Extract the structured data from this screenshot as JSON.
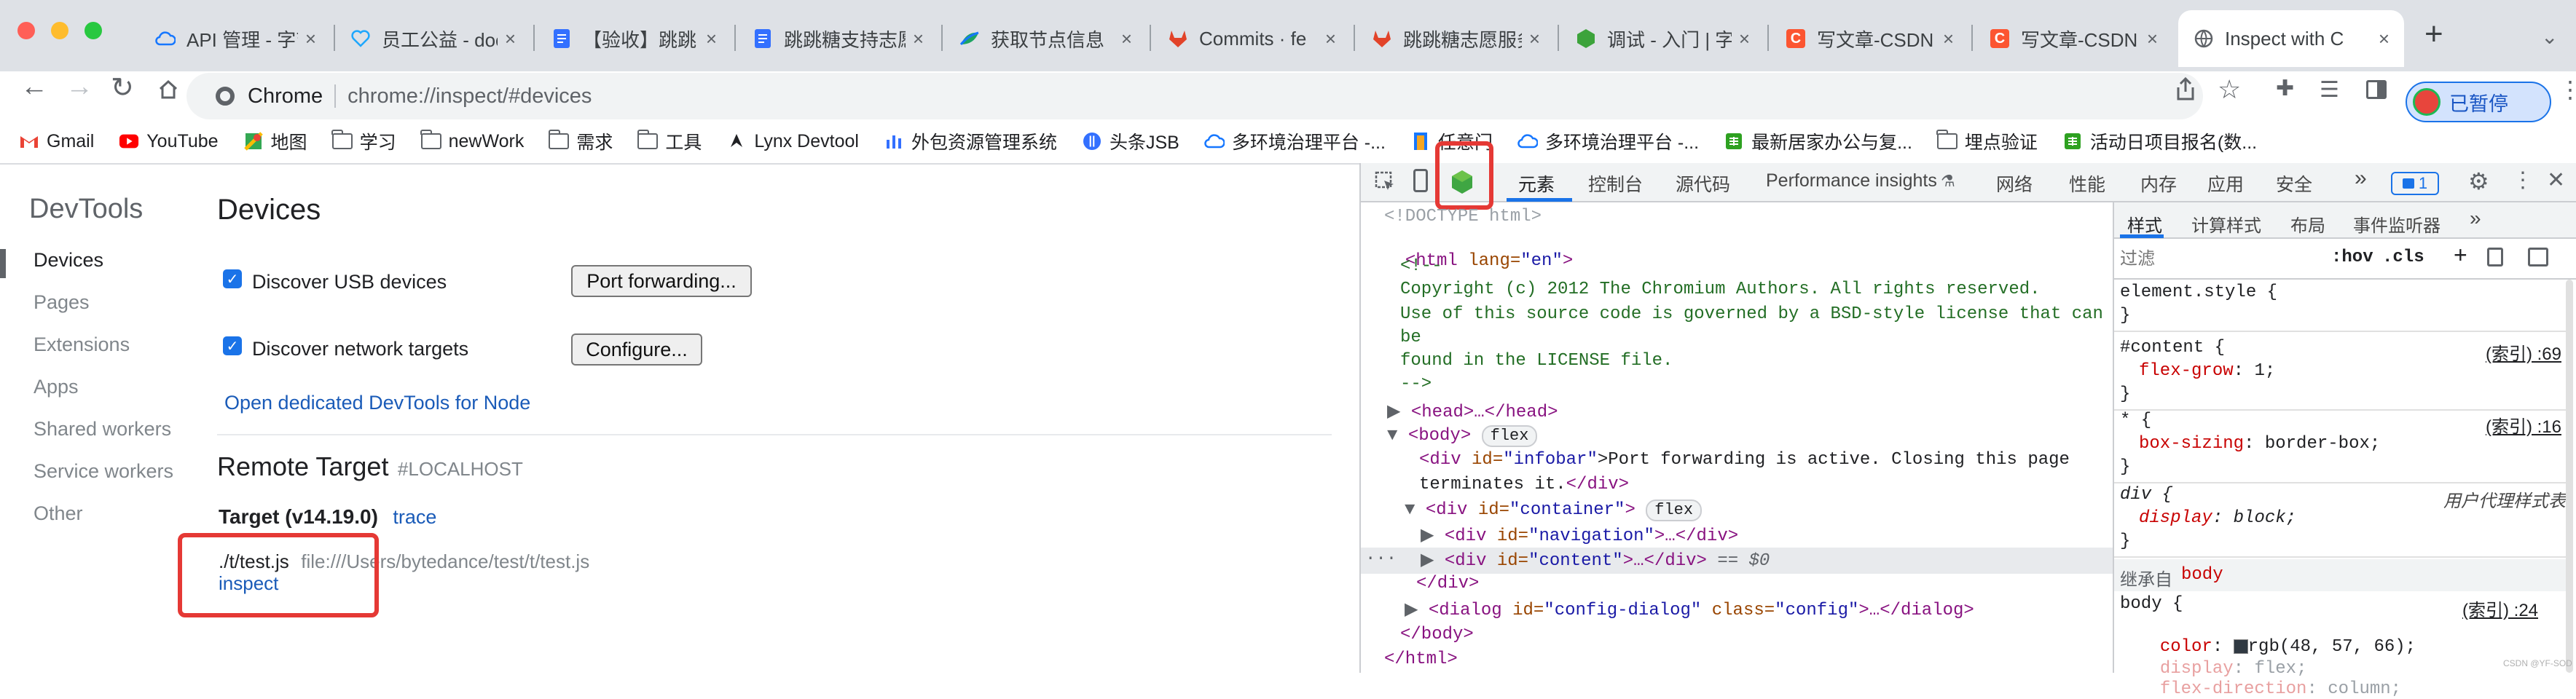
{
  "browser": {
    "tabs": [
      {
        "label": "API 管理 - 字节",
        "icon": "cloud-icon",
        "color": "#1677ff"
      },
      {
        "label": "员工公益 - doc",
        "icon": "heart-icon",
        "color": "#1ea7fd"
      },
      {
        "label": "【验收】跳跳",
        "icon": "doc-icon",
        "color": "#3370ff"
      },
      {
        "label": "跳跳糖支持志愿",
        "icon": "doc-icon",
        "color": "#3370ff"
      },
      {
        "label": "获取节点信息",
        "icon": "leaf-icon",
        "color": "#1da462"
      },
      {
        "label": "Commits · fe",
        "icon": "gitlab-icon",
        "color": "#e24329"
      },
      {
        "label": "跳跳糖志愿服务",
        "icon": "gitlab-icon",
        "color": "#e24329"
      },
      {
        "label": "调试 - 入门 | 字",
        "icon": "hexagon-icon",
        "color": "#3ca33b"
      },
      {
        "label": "写文章-CSDN",
        "icon": "csdn-icon",
        "color": "#fc5531"
      },
      {
        "label": "写文章-CSDN",
        "icon": "csdn-icon",
        "color": "#fc5531"
      },
      {
        "label": "Inspect with C",
        "icon": "globe-icon",
        "color": "#5f6368",
        "active": true
      }
    ],
    "url_scheme_label": "Chrome",
    "url": "chrome://inspect/#devices",
    "paused_label": "已暂停",
    "bookmarks": [
      {
        "label": "Gmail",
        "icon": "gmail-icon"
      },
      {
        "label": "YouTube",
        "icon": "youtube-icon"
      },
      {
        "label": "地图",
        "icon": "maps-icon"
      },
      {
        "label": "学习",
        "icon": "folder-icon"
      },
      {
        "label": "newWork",
        "icon": "folder-icon"
      },
      {
        "label": "需求",
        "icon": "folder-icon"
      },
      {
        "label": "工具",
        "icon": "folder-icon"
      },
      {
        "label": "Lynx Devtool",
        "icon": "lynx-icon"
      },
      {
        "label": "外包资源管理系统",
        "icon": "bar-chart-icon"
      },
      {
        "label": "头条JSB",
        "icon": "jsb-icon"
      },
      {
        "label": "多环境治理平台 -...",
        "icon": "cloud-icon"
      },
      {
        "label": "任意门",
        "icon": "door-icon"
      },
      {
        "label": "多环境治理平台 -...",
        "icon": "cloud-icon"
      },
      {
        "label": "最新居家办公与复...",
        "icon": "sheet-icon"
      },
      {
        "label": "埋点验证",
        "icon": "folder-icon"
      },
      {
        "label": "活动日项目报名(数...",
        "icon": "sheet-icon"
      }
    ]
  },
  "inspect": {
    "sidebar_title": "DevTools",
    "sidebar_items": [
      "Devices",
      "Pages",
      "Extensions",
      "Apps",
      "Shared workers",
      "Service workers",
      "Other"
    ],
    "heading": "Devices",
    "usb_label": "Discover USB devices",
    "port_forwarding_label": "Port forwarding...",
    "network_label": "Discover network targets",
    "configure_label": "Configure...",
    "node_link": "Open dedicated DevTools for Node",
    "remote_title": "Remote Target",
    "remote_host": "#LOCALHOST",
    "target_name": "Target (v14.19.0)",
    "trace_link": "trace",
    "script_name": "./t/test.js",
    "script_path": "file:///Users/bytedance/test/t/test.js",
    "inspect_link": "inspect"
  },
  "devtools": {
    "tabs": [
      "元素",
      "控制台",
      "源代码",
      "Performance insights",
      "网络",
      "性能",
      "内存",
      "应用",
      "安全"
    ],
    "more_tabs": "»",
    "issues_count": "1",
    "elements": {
      "doctype": "<!DOCTYPE html>",
      "html_open_tag": "<html",
      "html_lang_attr": " lang=",
      "html_lang_val": "\"en\"",
      "html_close_bracket": ">",
      "comment_open": "<!--",
      "comment_line1": "Copyright (c) 2012 The Chromium Authors. All rights reserved.",
      "comment_line2": "Use of this source code is governed by a BSD-style license that can",
      "comment_line3": "be",
      "comment_line4": "found in the LICENSE file.",
      "comment_close": "-->",
      "head_line": "<head>…</head>",
      "body_open": "<body>",
      "flex_badge": "flex",
      "infobar_open": "<div",
      "infobar_attr": " id=",
      "infobar_val": "\"infobar\"",
      "infobar_text": ">Port forwarding is active. Closing this page",
      "infobar_text2": "terminates it.",
      "infobar_close": "</div>",
      "container_open": "<div",
      "container_attr": " id=",
      "container_val": "\"container\"",
      "container_close_bracket": ">",
      "nav_open": "<div",
      "nav_attr": " id=",
      "nav_val": "\"navigation\"",
      "nav_rest": ">…</div>",
      "content_open": "<div",
      "content_attr": " id=",
      "content_val": "\"content\"",
      "content_rest": ">…</div>",
      "content_eq": " == $0",
      "div_close": "</div>",
      "dialog_open": "<dialog",
      "dialog_attr1": " id=",
      "dialog_val1": "\"config-dialog\"",
      "dialog_attr2": " class=",
      "dialog_val2": "\"config\"",
      "dialog_rest": ">…</dialog>",
      "body_close": "</body>",
      "html_close": "</html>",
      "ellipsis": "···"
    },
    "styles": {
      "tabs": [
        "样式",
        "计算样式",
        "布局",
        "事件监听器"
      ],
      "more": "»",
      "filter_placeholder": "过滤",
      "hov": ":hov",
      "cls": ".cls",
      "plus": "+",
      "rules": [
        {
          "selector": "element.style {",
          "source": "",
          "decls": [],
          "close": "}"
        },
        {
          "selector": "#content {",
          "source": "(索引) :69",
          "decls": [
            {
              "prop": "flex-grow",
              "value": "1;"
            }
          ],
          "close": "}"
        },
        {
          "selector": "* {",
          "source": "(索引) :16",
          "decls": [
            {
              "prop": "box-sizing",
              "value": "border-box;"
            }
          ],
          "close": "}"
        },
        {
          "selector": "div {",
          "source": "用户代理样式表",
          "decls": [
            {
              "prop": "display",
              "value": "block;"
            }
          ],
          "close": "}"
        }
      ],
      "inherited_label": "继承自",
      "inherited_from": "body",
      "body_rule_selector": "body {",
      "body_rule_source": "(索引) :24",
      "body_color_prop": "color",
      "body_color_value": "rgb(48, 57, 66);",
      "body_display_prop": "display",
      "body_display_value": "flex;",
      "body_flexdir_prop": "flex-direction",
      "body_flexdir_value": "column;"
    }
  },
  "watermark": "CSDN @YF-SOD",
  "colors": {
    "accent": "#1a73e8",
    "highlight": "#e53935",
    "swatch": "#303942"
  }
}
